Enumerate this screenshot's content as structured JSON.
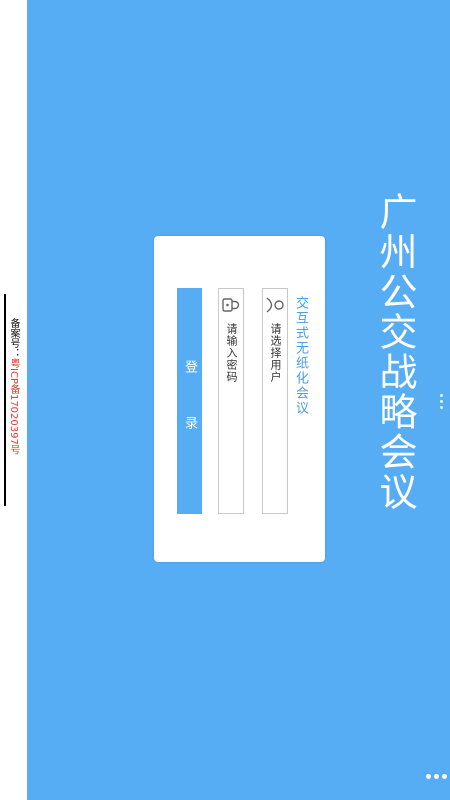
{
  "app": {
    "title": "广州公交战略会议"
  },
  "login": {
    "subtitle": "交互式无纸化会议",
    "username_placeholder": "请选择用户",
    "password_placeholder": "请输入密码",
    "login_label": "登 录"
  },
  "footer": {
    "icp_prefix": "备案号：",
    "icp_number": "粤ICP备17020397号"
  },
  "colors": {
    "background": "#56adf4",
    "accent": "#4a9be8",
    "icp_number": "#e53935"
  },
  "icons": {
    "username": "user-icon",
    "password": "lock-icon",
    "menu": "more-dots-icon"
  }
}
